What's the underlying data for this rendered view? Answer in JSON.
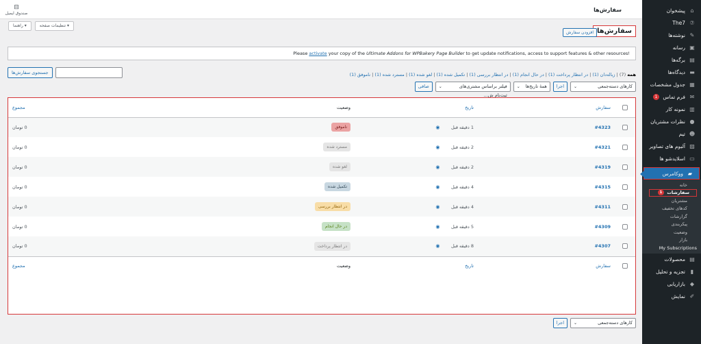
{
  "header": {
    "page_name": "سفارش‌ها",
    "inbox_label": "صندوق ایمیل"
  },
  "screen_buttons": {
    "screen_options": "تنظیمات صفحه ▾",
    "help": "راهنما ▾"
  },
  "page": {
    "title": "سفارش‌ها",
    "add_button": "افزودن سفارش"
  },
  "notice": {
    "pre": "Please ",
    "link": "activate",
    "mid": " your copy of the ",
    "product": "Ultimate Addons for WPBakery Page Builder",
    "post": " to get update notifications, access to support features & other resources!"
  },
  "search": {
    "button": "جستجوی سفارش‌ها",
    "placeholder": ""
  },
  "subsubsub": {
    "all": "همه",
    "all_count": "(7)",
    "items": [
      "زباله‌دان (1)",
      "در انتظار پرداخت (1)",
      "در حال انجام (1)",
      "در انتظار بررسی (1)",
      "تکمیل شده (1)",
      "لغو شده (1)",
      "مسترد شده (1)",
      "ناموفق (1)"
    ]
  },
  "filters": {
    "bulk_actions": "کارهای دسته‌جمعی",
    "apply": "اجرا",
    "all_dates": "همهٔ تاریخ‌ها",
    "customer_filter": "فیلتر براساس مشتری‌های ثبت‌نام ش...",
    "filter_button": "صافی"
  },
  "table": {
    "headers": {
      "order": "سفارش",
      "date": "تاریخ",
      "status": "وضعیت",
      "total": "مجموع"
    },
    "rows": [
      {
        "id": "#4323",
        "date": "1 دقیقه قبل",
        "status": "ناموفق",
        "total": "0 تومان"
      },
      {
        "id": "#4321",
        "date": "2 دقیقه قبل",
        "status": "مسترد شده",
        "total": "0 تومان"
      },
      {
        "id": "#4319",
        "date": "2 دقیقه قبل",
        "status": "لغو شده",
        "total": "0 تومان"
      },
      {
        "id": "#4315",
        "date": "4 دقیقه قبل",
        "status": "تکمیل شده",
        "total": "0 تومان"
      },
      {
        "id": "#4311",
        "date": "4 دقیقه قبل",
        "status": "در انتظار بررسی",
        "total": "0 تومان"
      },
      {
        "id": "#4309",
        "date": "5 دقیقه قبل",
        "status": "در حال انجام",
        "total": "0 تومان"
      },
      {
        "id": "#4307",
        "date": "8 دقیقه قبل",
        "status": "در انتظار پرداخت",
        "total": "0 تومان"
      }
    ]
  },
  "status_colors": {
    "ناموفق": {
      "bg": "#eba3a3",
      "fg": "#761919"
    },
    "مسترد شده": {
      "bg": "#e5e5e5",
      "fg": "#777777"
    },
    "لغو شده": {
      "bg": "#e5e5e5",
      "fg": "#777777"
    },
    "تکمیل شده": {
      "bg": "#c8d7e1",
      "fg": "#2e4453"
    },
    "در انتظار بررسی": {
      "bg": "#f8dda7",
      "fg": "#94660c"
    },
    "در حال انجام": {
      "bg": "#c6e1c6",
      "fg": "#5b841b"
    },
    "در انتظار پرداخت": {
      "bg": "#e5e5e5",
      "fg": "#777777"
    }
  },
  "sidebar": {
    "items": [
      {
        "label": "پیشخوان",
        "icon": "dashboard-icon"
      },
      {
        "label": "The7",
        "icon": "the7-icon"
      },
      {
        "label": "نوشته‌ها",
        "icon": "pin-icon"
      },
      {
        "label": "رسانه",
        "icon": "media-icon"
      },
      {
        "label": "برگه‌ها",
        "icon": "page-icon"
      },
      {
        "label": "دیدگاه‌ها",
        "icon": "comment-icon"
      },
      {
        "label": "جدول مشخصات",
        "icon": "table-icon"
      },
      {
        "label": "فرم تماس",
        "icon": "mail-icon",
        "count": "1"
      },
      {
        "label": "نمونه کار",
        "icon": "portfolio-icon"
      },
      {
        "label": "نظرات مشتریان",
        "icon": "testimonial-icon"
      },
      {
        "label": "تیم",
        "icon": "team-icon"
      },
      {
        "label": "آلبوم های تصاویر",
        "icon": "gallery-icon"
      },
      {
        "label": "اسلایدشو ها",
        "icon": "slideshow-icon"
      }
    ],
    "woo": {
      "label": "ووکامرس",
      "icon": "woo-icon"
    },
    "woo_sub": [
      {
        "label": "خانه"
      },
      {
        "label": "سفارشات",
        "count": "1",
        "current": true
      },
      {
        "label": "مشتریان"
      },
      {
        "label": "کدهای تخفیف"
      },
      {
        "label": "گزارشات"
      },
      {
        "label": "پیکربندی"
      },
      {
        "label": "وضعیت"
      },
      {
        "label": "بازار"
      },
      {
        "label": "My Subscriptions"
      }
    ],
    "after": [
      {
        "label": "محصولات",
        "icon": "products-icon"
      },
      {
        "label": "تجزیه و تحلیل",
        "icon": "analytics-icon"
      },
      {
        "label": "بازاریابی",
        "icon": "marketing-icon"
      },
      {
        "label": "نمایش",
        "icon": "appearance-icon"
      }
    ]
  },
  "icons": {
    "dashboard-icon": "⌂",
    "the7-icon": "⑦",
    "pin-icon": "✎",
    "media-icon": "▣",
    "page-icon": "▤",
    "comment-icon": "▬",
    "table-icon": "▦",
    "mail-icon": "✉",
    "portfolio-icon": "▥",
    "testimonial-icon": "●",
    "team-icon": "☻",
    "gallery-icon": "▨",
    "slideshow-icon": "▭",
    "woo-icon": "▰",
    "products-icon": "▤",
    "analytics-icon": "▮",
    "marketing-icon": "◆",
    "appearance-icon": "✐"
  }
}
